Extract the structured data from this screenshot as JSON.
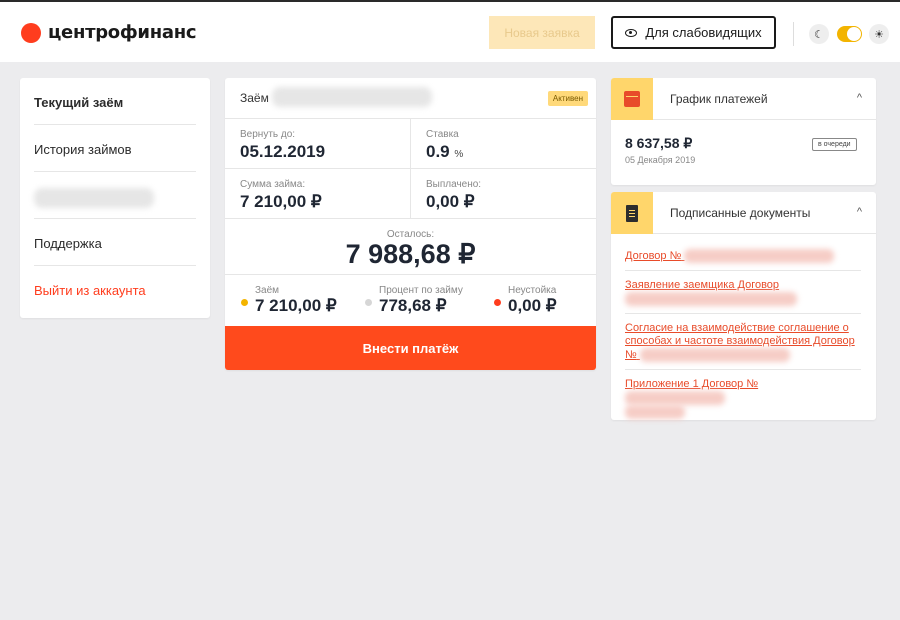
{
  "header": {
    "logo_text": "центрофинанс",
    "new_request_label": "Новая заявка",
    "low_vision_label": "Для слабовидящих",
    "accent": "#ff3d1e"
  },
  "sidebar": {
    "items": [
      {
        "label": "Текущий заём"
      },
      {
        "label": "История займов"
      },
      {
        "label": ""
      },
      {
        "label": "Поддержка"
      },
      {
        "label": "Выйти из аккаунта"
      }
    ]
  },
  "loan": {
    "title": "Заём",
    "status": "Активен",
    "due_label": "Вернуть до:",
    "due_value": "05.12.2019",
    "rate_label": "Ставка",
    "rate_value": "0.9",
    "rate_unit": "%",
    "amount_label": "Сумма займа:",
    "amount_value": "7 210,00 ₽",
    "paid_label": "Выплачено:",
    "paid_value": "0,00 ₽",
    "remaining_label": "Осталось:",
    "remaining_value": "7 988,68 ₽",
    "breakdown": [
      {
        "label": "Заём",
        "value": "7 210,00 ₽",
        "color": "#f3b400"
      },
      {
        "label": "Процент по займу",
        "value": "778,68 ₽",
        "color": "#d6d6d6"
      },
      {
        "label": "Неустойка",
        "value": "0,00 ₽",
        "color": "#ff3d1e"
      }
    ],
    "pay_button": "Внести платёж"
  },
  "schedule": {
    "title": "График платежей",
    "amount": "8 637,58 ₽",
    "date": "05 Декабря 2019",
    "status": "в очереди"
  },
  "documents": {
    "title": "Подписанные документы",
    "items": [
      {
        "label": "Договор №"
      },
      {
        "label": "Заявление заемщика Договор"
      },
      {
        "label": "Согласие на взаимодействие соглашение о способах и частоте взаимодействия Договор №"
      },
      {
        "label": "Приложение 1 Договор №"
      }
    ]
  }
}
